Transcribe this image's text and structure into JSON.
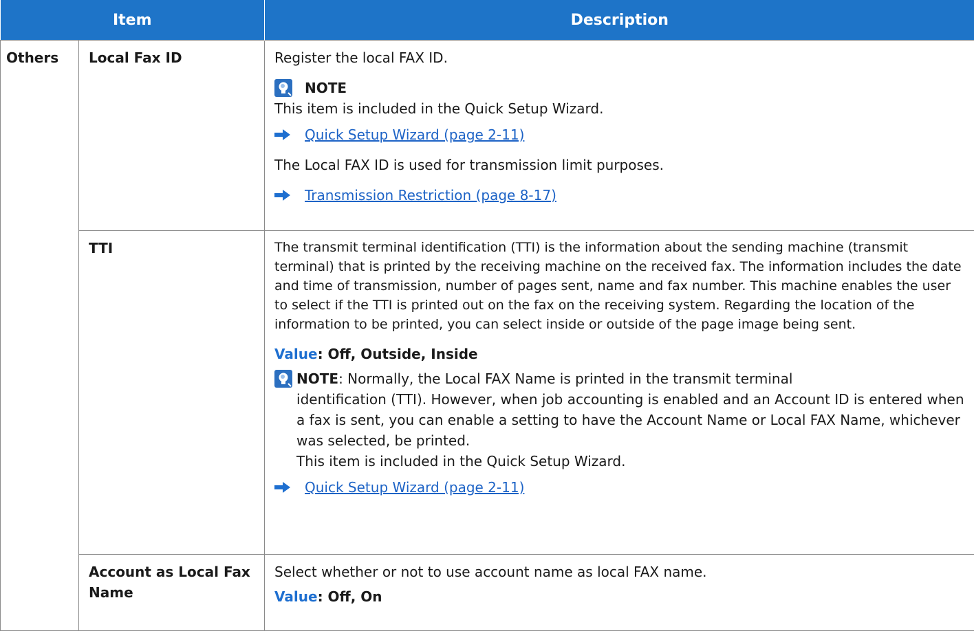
{
  "header": {
    "item": "Item",
    "description": "Description"
  },
  "category": "Others",
  "rows": {
    "local_fax_id": {
      "name": "Local Fax ID",
      "intro": "Register the local FAX ID.",
      "note_title": "NOTE",
      "note_text": "This item is included in the Quick Setup Wizard.",
      "link1": "Quick Setup Wizard (page 2-11)",
      "text2": "The Local FAX ID is used for transmission limit purposes.",
      "link2": "Transmission Restriction (page 8-17)"
    },
    "tti": {
      "name": "TTI",
      "body": "The transmit terminal identification (TTI) is the information about the sending machine (transmit terminal) that is printed by the receiving machine on the received fax. The information includes the date and time of transmission, number of pages sent, name and fax number. This machine enables the user to select if the TTI is printed out on the fax on the receiving system. Regarding the location of the information to be printed, you can select inside or outside of the page image being sent.",
      "value_label": "Value",
      "value_text": ": Off, Outside, Inside",
      "note_title": "NOTE",
      "note_line1": ": Normally, the Local FAX Name is printed in the transmit terminal",
      "note_rest": "identification (TTI). However, when job accounting is enabled and an Account ID is entered when a fax is sent, you can enable a setting to have the Account Name or Local FAX Name, whichever was selected, be printed.",
      "note_line_last": "This item is included in the Quick Setup Wizard.",
      "link": "Quick Setup Wizard (page 2-11)"
    },
    "account": {
      "name": "Account as Local Fax Name",
      "desc": "Select whether or not to use account name as local FAX name.",
      "value_label": "Value",
      "value_text": ": Off, On"
    }
  },
  "colors": {
    "header_bg": "#1e74c8",
    "link": "#1d63c6",
    "value_label": "#1e6fd0"
  }
}
